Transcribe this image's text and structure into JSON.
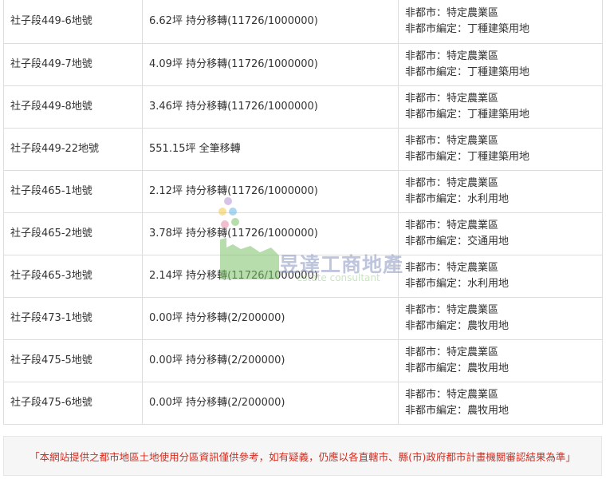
{
  "rows": [
    {
      "lot": "社子段449-6地號",
      "area": "6.62坪 持分移轉(11726/1000000)",
      "zone_line1": "非都市：特定農業區",
      "zone_line2": "非都市編定：丁種建築用地"
    },
    {
      "lot": "社子段449-7地號",
      "area": "4.09坪 持分移轉(11726/1000000)",
      "zone_line1": "非都市：特定農業區",
      "zone_line2": "非都市編定：丁種建築用地"
    },
    {
      "lot": "社子段449-8地號",
      "area": "3.46坪 持分移轉(11726/1000000)",
      "zone_line1": "非都市：特定農業區",
      "zone_line2": "非都市編定：丁種建築用地"
    },
    {
      "lot": "社子段449-22地號",
      "area": "551.15坪 全筆移轉",
      "zone_line1": "非都市：特定農業區",
      "zone_line2": "非都市編定：丁種建築用地"
    },
    {
      "lot": "社子段465-1地號",
      "area": "2.12坪 持分移轉(11726/1000000)",
      "zone_line1": "非都市：特定農業區",
      "zone_line2": "非都市編定：水利用地"
    },
    {
      "lot": "社子段465-2地號",
      "area": "3.78坪 持分移轉(11726/1000000)",
      "zone_line1": "非都市：特定農業區",
      "zone_line2": "非都市編定：交通用地"
    },
    {
      "lot": "社子段465-3地號",
      "area": "2.14坪 持分移轉(11726/1000000)",
      "zone_line1": "非都市：特定農業區",
      "zone_line2": "非都市編定：水利用地"
    },
    {
      "lot": "社子段473-1地號",
      "area": "0.00坪 持分移轉(2/200000)",
      "zone_line1": "非都市：特定農業區",
      "zone_line2": "非都市編定：農牧用地"
    },
    {
      "lot": "社子段475-5地號",
      "area": "0.00坪 持分移轉(2/200000)",
      "zone_line1": "非都市：特定農業區",
      "zone_line2": "非都市編定：農牧用地"
    },
    {
      "lot": "社子段475-6地號",
      "area": "0.00坪 持分移轉(2/200000)",
      "zone_line1": "非都市：特定農業區",
      "zone_line2": "非都市編定：農牧用地"
    }
  ],
  "watermark": {
    "name": "昱達工商地產",
    "sub": "estate consultant",
    "colors": {
      "green": "#7dc36b",
      "yellow": "#f2c94c",
      "blue": "#6bb7e6",
      "pink": "#e88aa8",
      "purple": "#b792d6"
    }
  },
  "notice": "「本網站提供之都市地區土地使用分區資訊僅供參考，如有疑義，仍應以各直轄市、縣(市)政府都市計畫機關審認結果為準」",
  "colors": {
    "notice_text": "#d52b1e",
    "border": "#dddddd"
  }
}
